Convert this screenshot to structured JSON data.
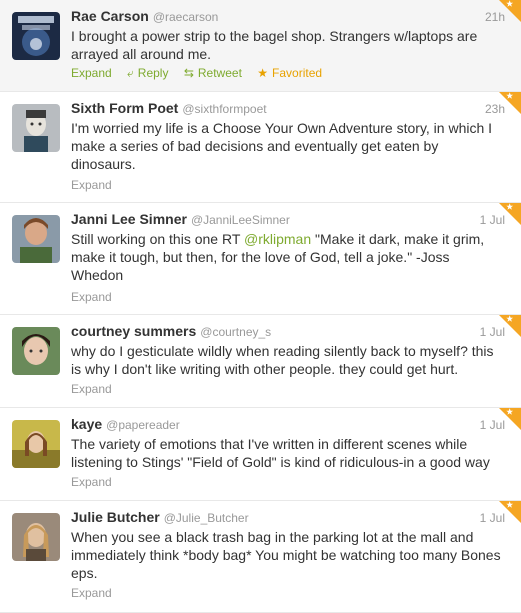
{
  "tweets": [
    {
      "fullname": "Rae Carson",
      "username": "@raecarson",
      "time": "21h",
      "text": "I brought a power strip to the bagel shop. Strangers w/laptops are arrayed all around me.",
      "actions": {
        "expand": "Expand",
        "reply": "Reply",
        "retweet": "Retweet",
        "favorited": "Favorited"
      }
    },
    {
      "fullname": "Sixth Form Poet",
      "username": "@sixthformpoet",
      "time": "23h",
      "text": "I'm worried my life is a Choose Your Own Adventure story, in which I make a series of bad decisions and eventually get eaten by dinosaurs.",
      "actions": {
        "expand": "Expand"
      }
    },
    {
      "fullname": "Janni Lee Simner",
      "username": "@JanniLeeSimner",
      "time": "1 Jul",
      "text_before": "Still working on this one RT ",
      "mention": "@rklipman",
      "text_after": " \"Make it dark, make it grim, make it tough, but then, for the love of God, tell a joke.\" -Joss Whedon",
      "actions": {
        "expand": "Expand"
      }
    },
    {
      "fullname": "courtney summers",
      "username": "@courtney_s",
      "time": "1 Jul",
      "text": "why do I gesticulate wildly when reading silently back to myself? this is why I don't like writing with other people. they could get hurt.",
      "actions": {
        "expand": "Expand"
      }
    },
    {
      "fullname": "kaye",
      "username": "@papereader",
      "time": "1 Jul",
      "text": "The variety of emotions that I've written in different scenes while listening to Stings' \"Field of Gold\" is kind of ridiculous-in a good way",
      "actions": {
        "expand": "Expand"
      }
    },
    {
      "fullname": "Julie Butcher",
      "username": "@Julie_Butcher",
      "time": "1 Jul",
      "text": "When you see a black trash bag in the parking lot at the mall and immediately think *body bag* You might be watching too many Bones eps.",
      "actions": {
        "expand": "Expand"
      }
    }
  ],
  "colors": {
    "link_green": "#7eaa2f",
    "favorite_orange": "#e8a200",
    "corner_orange": "#f5a623"
  },
  "icons": {
    "reply": "reply-arrow-icon",
    "retweet": "retweet-icon",
    "favorite": "star-icon",
    "corner": "favorite-corner-ribbon-icon"
  }
}
